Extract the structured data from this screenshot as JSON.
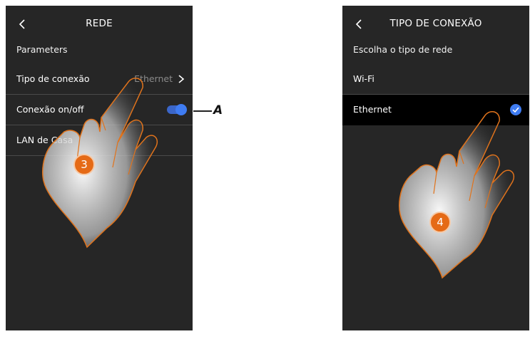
{
  "left_screen": {
    "title": "REDE",
    "section_label": "Parameters",
    "rows": [
      {
        "label": "Tipo de conexão",
        "value": "Ethernet"
      },
      {
        "label": "Conexão on/off",
        "toggle_on": true
      },
      {
        "label": "LAN de Casa"
      }
    ]
  },
  "right_screen": {
    "title": "TIPO DE CONEXÃO",
    "section_label": "Escolha o tipo de rede",
    "options": [
      {
        "label": "Wi-Fi",
        "selected": false
      },
      {
        "label": "Ethernet",
        "selected": true
      }
    ]
  },
  "annotations": {
    "step_left": "3",
    "step_right": "4",
    "callout": "A"
  },
  "colors": {
    "screen_bg": "#262626",
    "accent_blue": "#3f7cf2",
    "step_orange": "#e56a16",
    "hand_outline": "#e0731c"
  },
  "icons": {
    "back": "chevron-left-icon",
    "forward": "chevron-right-icon",
    "check": "check-circle-icon",
    "pointer": "pointing-hand-icon"
  }
}
